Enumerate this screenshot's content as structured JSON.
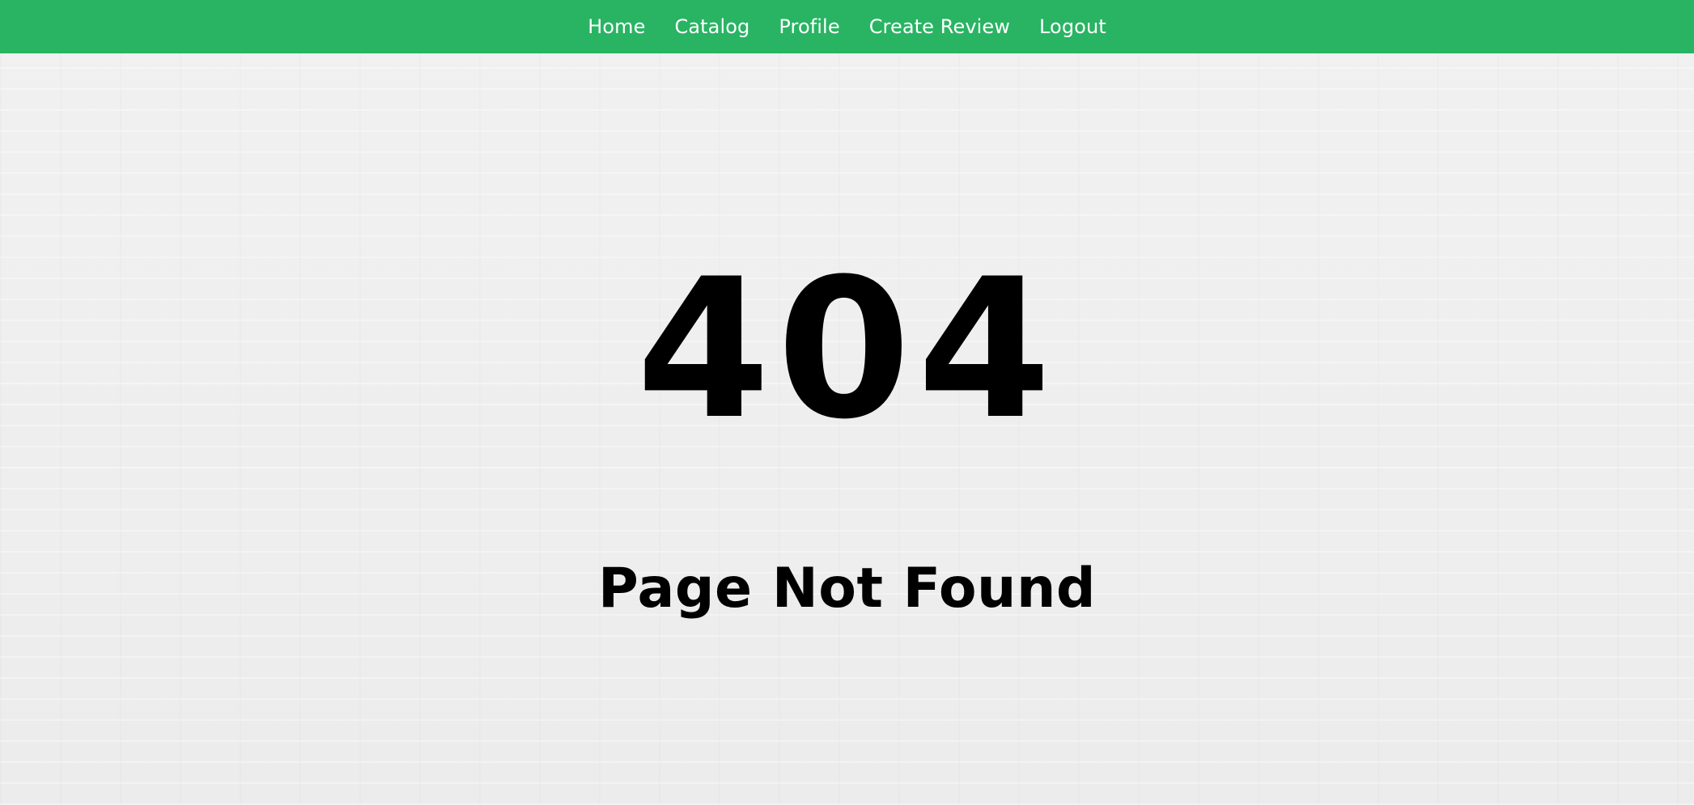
{
  "nav": {
    "items": [
      {
        "label": "Home"
      },
      {
        "label": "Catalog"
      },
      {
        "label": "Profile"
      },
      {
        "label": "Create Review"
      },
      {
        "label": "Logout"
      }
    ],
    "background_color": "#29b463",
    "text_color": "#ffffff"
  },
  "content": {
    "code": "404",
    "message": "Page Not Found",
    "text_color": "#000000",
    "background_color": "#efefef"
  }
}
